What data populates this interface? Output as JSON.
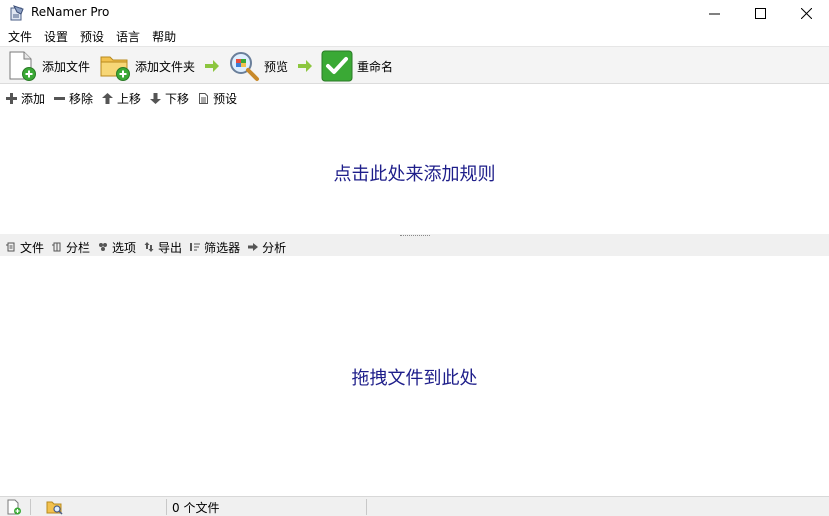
{
  "window": {
    "title": "ReNamer Pro"
  },
  "menu": [
    "文件",
    "设置",
    "预设",
    "语言",
    "帮助"
  ],
  "toolbar": {
    "add_files": "添加文件",
    "add_folders": "添加文件夹",
    "preview": "预览",
    "rename": "重命名"
  },
  "rules_toolbar": [
    "添加",
    "移除",
    "上移",
    "下移",
    "预设"
  ],
  "rules_hint": "点击此处来添加规则",
  "files_toolbar": [
    "文件",
    "分栏",
    "选项",
    "导出",
    "筛选器",
    "分析"
  ],
  "files_hint": "拖拽文件到此处",
  "status": {
    "count": "0 个文件"
  },
  "colors": {
    "hint": "#1e1e8a",
    "accent_green": "#3aa935",
    "arrow": "#8cc63f"
  }
}
